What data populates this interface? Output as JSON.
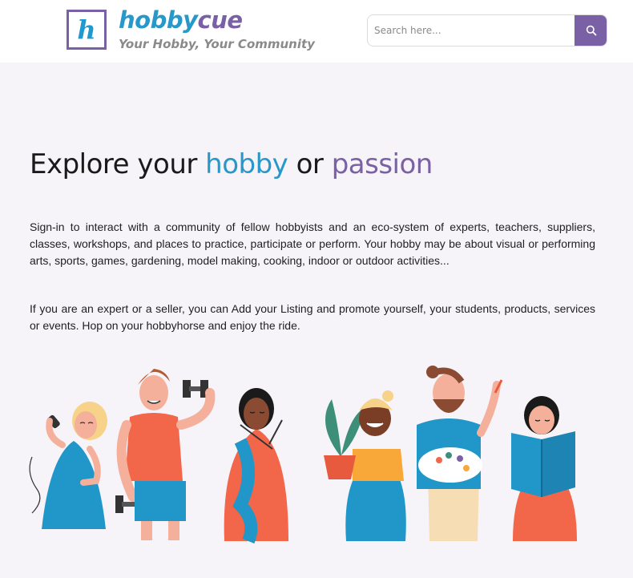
{
  "header": {
    "logo_letter": "h",
    "brand_part1": "hobby",
    "brand_part2": "cue",
    "tagline": "Your Hobby, Your Community",
    "search_placeholder": "Search here...",
    "search_icon": "search-icon"
  },
  "hero": {
    "title_part1": "Explore your ",
    "title_hobby": "hobby",
    "title_or": " or ",
    "title_passion": "passion",
    "paragraph1": "Sign-in to interact with a community of fellow hobbyists and an eco-system of experts, teachers, suppliers, classes, workshops, and places to practice, participate or perform. Your hobby may be about visual or performing arts, sports, games, gardening, model making, cooking, indoor or outdoor activities...",
    "paragraph2": "If you are an expert or a seller, you can Add your Listing and promote yourself, your students, products, services or events. Hop on your hobbyhorse and enjoy the ride."
  },
  "colors": {
    "brand_blue": "#2897c9",
    "brand_purple": "#7a61a6",
    "page_bg": "#f6f3f9"
  }
}
